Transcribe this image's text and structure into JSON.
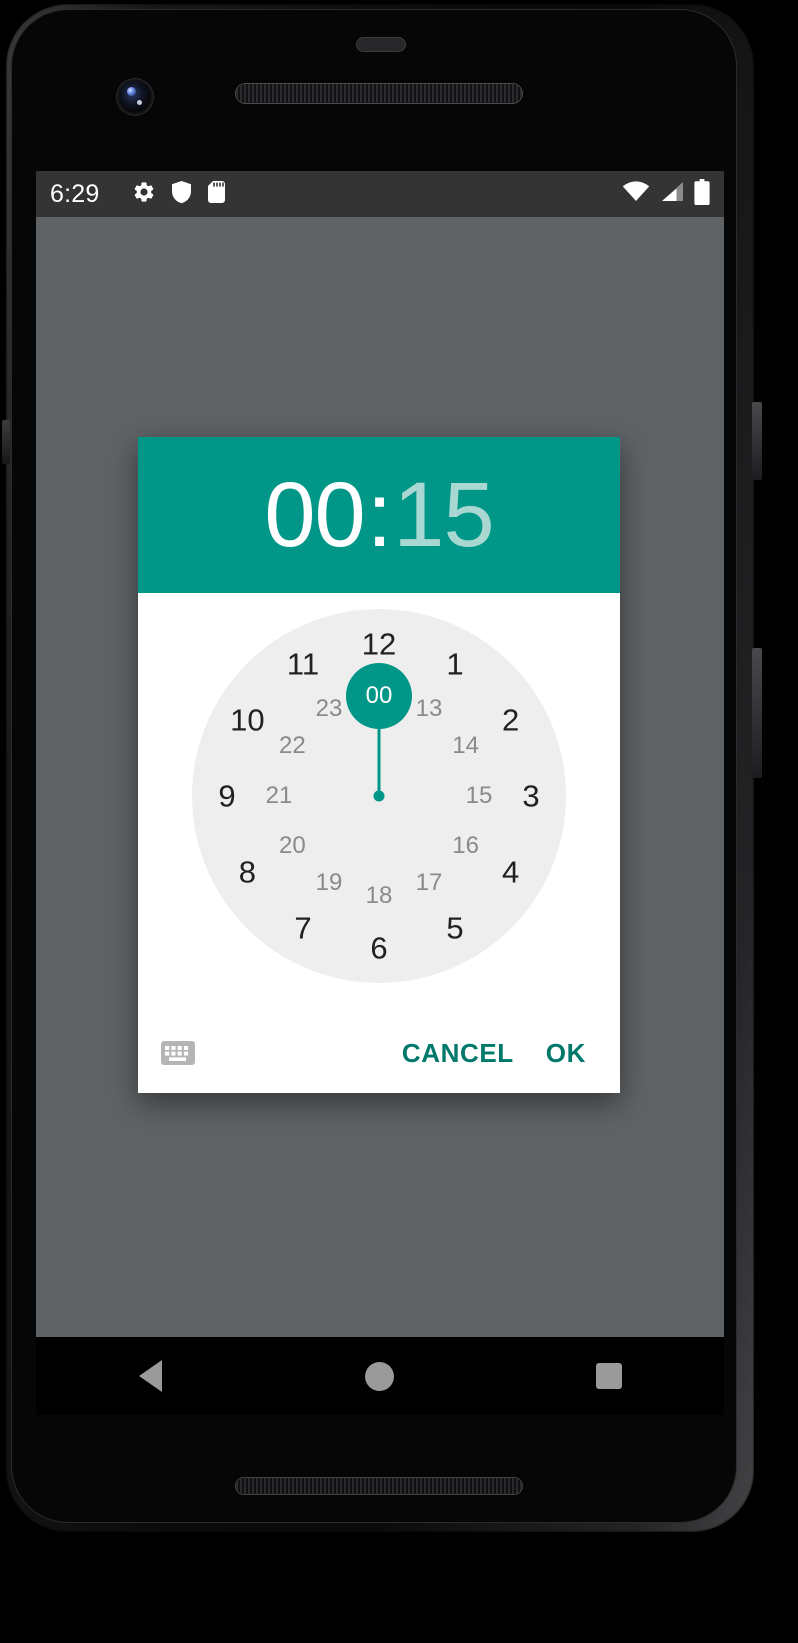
{
  "device": {
    "name": "android-phone",
    "camera_icon": "front-camera",
    "earpiece_icon": "earpiece-speaker",
    "bottom_speaker_icon": "bottom-speaker"
  },
  "statusbar": {
    "time": "6:29",
    "left_icons": [
      {
        "name": "settings-gear-icon",
        "label": "gear"
      },
      {
        "name": "shield-icon",
        "label": "shield"
      },
      {
        "name": "sd-card-icon",
        "label": "sd-card"
      }
    ],
    "right_icons": [
      {
        "name": "wifi-icon",
        "label": "wifi"
      },
      {
        "name": "cellular-signal-icon",
        "label": "signal"
      },
      {
        "name": "battery-icon",
        "label": "battery"
      }
    ],
    "background": "#343434",
    "foreground": "#ffffff"
  },
  "dialog": {
    "name": "time-picker-dialog",
    "time": {
      "hour": "00",
      "separator": ":",
      "minute": "15",
      "active_field": "hour"
    },
    "header_color": "#009688",
    "accent_color": "#009688",
    "action_color": "#00796b",
    "clock": {
      "mode": "24-hour",
      "selected_value": "00",
      "selected_angle_deg": 0,
      "outer_ring_labels": [
        "12",
        "1",
        "2",
        "3",
        "4",
        "5",
        "6",
        "7",
        "8",
        "9",
        "10",
        "11"
      ],
      "inner_ring_labels": [
        "00",
        "13",
        "14",
        "15",
        "16",
        "17",
        "18",
        "19",
        "20",
        "21",
        "22",
        "23"
      ],
      "face_color": "#eeeeee",
      "outer_text_color": "#212121",
      "inner_text_color": "#8a8a8a"
    },
    "actions": {
      "keyboard_icon": "keyboard-icon",
      "cancel_label": "CANCEL",
      "ok_label": "OK"
    }
  },
  "navbar": {
    "back_label": "Back",
    "home_label": "Home",
    "recents_label": "Recents",
    "icons": [
      "back-triangle-icon",
      "home-circle-icon",
      "recents-square-icon"
    ]
  }
}
